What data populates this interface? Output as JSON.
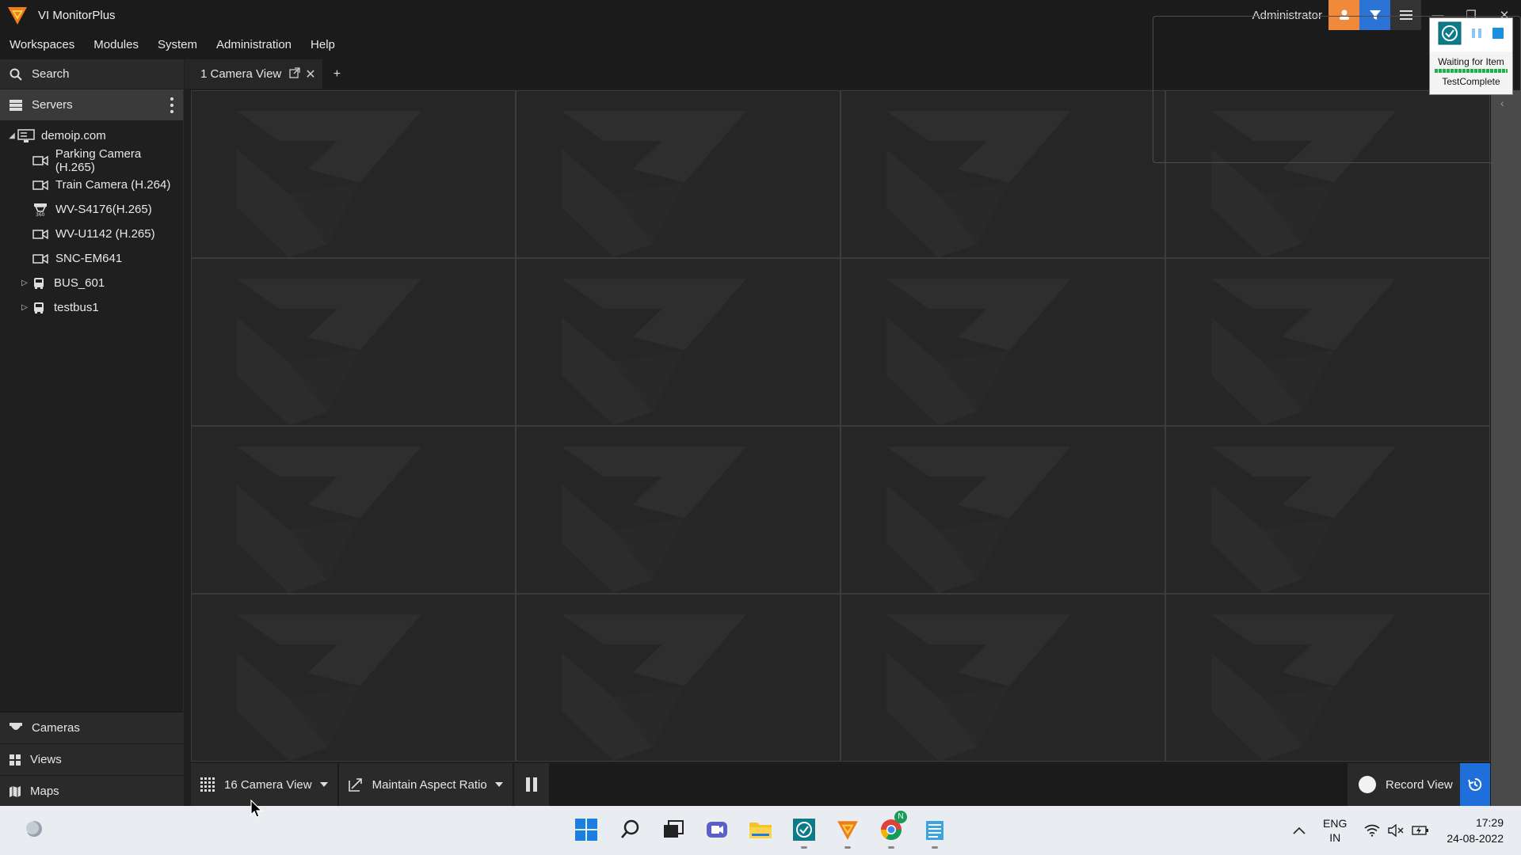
{
  "app": {
    "title": "VI MonitorPlus",
    "user": "Administrator"
  },
  "menu": [
    "Workspaces",
    "Modules",
    "System",
    "Administration",
    "Help"
  ],
  "sidebar": {
    "search_label": "Search",
    "servers_label": "Servers",
    "tree": {
      "server": "demoip.com",
      "cameras": [
        {
          "label": "Parking Camera (H.265)",
          "icon": "camera-icon"
        },
        {
          "label": "Train Camera (H.264)",
          "icon": "camera-icon"
        },
        {
          "label": "WV-S4176(H.265)",
          "icon": "360-camera-icon"
        },
        {
          "label": "WV-U1142 (H.265)",
          "icon": "camera-icon"
        },
        {
          "label": "SNC-EM641",
          "icon": "camera-icon"
        }
      ],
      "groups": [
        {
          "label": "BUS_601",
          "icon": "bus-icon"
        },
        {
          "label": "testbus1",
          "icon": "bus-icon"
        }
      ]
    },
    "bottom_nav": [
      {
        "label": "Cameras",
        "icon": "dome-camera-icon"
      },
      {
        "label": "Views",
        "icon": "grid-icon"
      },
      {
        "label": "Maps",
        "icon": "map-icon"
      }
    ]
  },
  "tabs": [
    {
      "label": "1 Camera View"
    }
  ],
  "tab_add": "+",
  "bottombar": {
    "layout_label": "16 Camera View",
    "aspect_label": "Maintain Aspect Ratio",
    "record_label": "Record View"
  },
  "testcomplete": {
    "status": "Waiting for Item",
    "name": "TestComplete"
  },
  "taskbar": {
    "lang_top": "ENG",
    "lang_bottom": "IN",
    "time": "17:29",
    "date": "24-08-2022",
    "chrome_badge": "N"
  },
  "colors": {
    "accent_orange": "#f0893a",
    "accent_blue": "#2b74d6",
    "record_blue": "#1e6fd9"
  }
}
